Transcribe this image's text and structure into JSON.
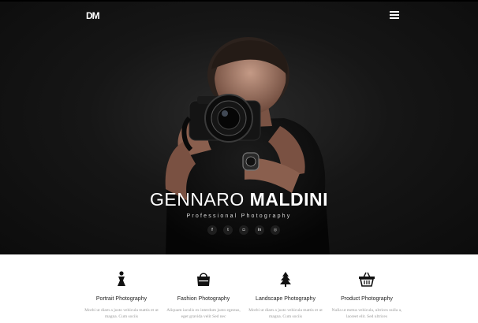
{
  "header": {
    "logo_text": "DM",
    "menu_icon": "hamburger-menu-icon"
  },
  "hero": {
    "title_first": "GENNARO",
    "title_last": "MALDINI",
    "subtitle": "Professional Photography",
    "social_links": [
      {
        "icon": "facebook-icon",
        "glyph": "f"
      },
      {
        "icon": "twitter-icon",
        "glyph": "t"
      },
      {
        "icon": "instagram-icon",
        "glyph": "◘"
      },
      {
        "icon": "linkedin-icon",
        "glyph": "in"
      },
      {
        "icon": "dribbble-icon",
        "glyph": "◎"
      }
    ]
  },
  "services": [
    {
      "icon": "portrait-person-icon",
      "label": "Portrait Photography",
      "desc": "Morbi ut diam a justo vehicula mattis et ut magna. Cum sociis"
    },
    {
      "icon": "shopping-bag-icon",
      "label": "Fashion Photography",
      "desc": "Aliquam iaculis ex interdum justo egestas, eget gravida velit Sed nec"
    },
    {
      "icon": "pine-tree-icon",
      "label": "Landscape Photography",
      "desc": "Morbi ut diam a justo vehicula mattis et ut magna. Cum sociis"
    },
    {
      "icon": "shopping-basket-icon",
      "label": "Product Photography",
      "desc": "Nulla ut metus vehicula, ultrices nulla a, laoreet elit. Sed ultrices"
    }
  ],
  "colors": {
    "hero_background": "#111111",
    "text_light": "#ffffff",
    "body_text": "#9a9a9a"
  }
}
